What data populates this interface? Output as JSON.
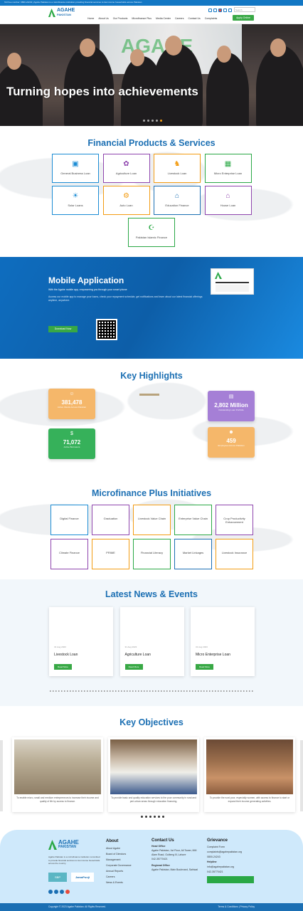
{
  "topbar": {
    "text": "Toll free number: 0800-24243 | Agahe Pakistan is a microfinance institution providing financial services to low income households across Pakistan"
  },
  "brand": {
    "name_line1": "AGAHE",
    "name_line2": "PAKISTAN"
  },
  "nav": {
    "items": [
      "Home",
      "About Us",
      "Our Products",
      "Microfinance Plus",
      "Media Center",
      "Careers",
      "Contact Us",
      "Complaints"
    ],
    "search_placeholder": "Search",
    "cta_label": "Apply Online"
  },
  "hero": {
    "title": "Turning hopes into achievements",
    "banner_text": "AGAHE"
  },
  "products": {
    "title": "Financial Products & Services",
    "items": [
      {
        "label": "General Business Loan",
        "color": "#1b8cd4",
        "icon": "briefcase-icon"
      },
      {
        "label": "Agriculture Loan",
        "color": "#8e44ad",
        "icon": "plant-icon"
      },
      {
        "label": "Livestock Loan",
        "color": "#f39c12",
        "icon": "cow-icon"
      },
      {
        "label": "Micro Enterprise Loan",
        "color": "#2aa845",
        "icon": "store-icon"
      },
      {
        "label": "Solar Loans",
        "color": "#1b8cd4",
        "icon": "sun-icon"
      },
      {
        "label": "Auto Loan",
        "color": "#f39c12",
        "icon": "bike-icon"
      },
      {
        "label": "Education Finance",
        "color": "#1b6fb3",
        "icon": "school-icon"
      },
      {
        "label": "House Loan",
        "color": "#8e44ad",
        "icon": "house-icon"
      },
      {
        "label": "Pakistan Islamic Finance",
        "color": "#2aa845",
        "icon": "islamic-icon"
      }
    ]
  },
  "mobile": {
    "title": "Mobile Application",
    "subtitle": "With the Agahe mobile app, empowering you through your smart phone",
    "body": "Access our mobile app to manage your loans, check your repayment schedule, get notifications and learn about our latest financial offerings anytime, anywhere.",
    "download_label": "Download Now"
  },
  "highlights": {
    "title": "Key Highlights",
    "stats": [
      {
        "value": "381,478",
        "label": "Active Clients Across Pakistan",
        "color": "#f5b76a"
      },
      {
        "value": "2,802 Million",
        "label": "Outstanding Loan Portfolio",
        "color": "#a57fd6"
      },
      {
        "value": "71,072",
        "label": "Active Borrowers",
        "color": "#36b15a"
      },
      {
        "value": "459",
        "label": "Employees Across Pakistan",
        "color": "#f5b76a"
      }
    ]
  },
  "initiatives": {
    "title": "Microfinance Plus Initiatives",
    "items": [
      {
        "label": "Digital Finance",
        "color": "#1b8cd4"
      },
      {
        "label": "Graduation",
        "color": "#8e44ad"
      },
      {
        "label": "Livestock Value Chain",
        "color": "#f39c12"
      },
      {
        "label": "Enterprise Value Chain",
        "color": "#2aa845"
      },
      {
        "label": "Crop Productivity Enhancement",
        "color": "#8e44ad"
      },
      {
        "label": "Climate Finance",
        "color": "#8e44ad"
      },
      {
        "label": "PRIME",
        "color": "#f39c12"
      },
      {
        "label": "Financial Literacy",
        "color": "#2aa845"
      },
      {
        "label": "Market Linkages",
        "color": "#1b6fb3"
      },
      {
        "label": "Livestock Insurance",
        "color": "#f39c12"
      }
    ]
  },
  "news": {
    "title": "Latest News & Events",
    "items": [
      {
        "date": "31 Aug 2023",
        "title": "Livestock Loan",
        "button": "Read More"
      },
      {
        "date": "31 Aug 2023",
        "title": "Agriculture Loan",
        "button": "Read More"
      },
      {
        "date": "31 Aug 2023",
        "title": "Micro Enterprise Loan",
        "button": "Read More"
      }
    ]
  },
  "objectives": {
    "title": "Key Objectives",
    "items": [
      {
        "caption": "To enable micro, small and medium entrepreneurs to increase their income and quality of life by access to finance."
      },
      {
        "caption": "To provide basic and quality education services to the poor community in rural and peri-urban areas through education financing."
      },
      {
        "caption": "To provide the rural poor, especially women, with access to finance to start or expand their income generating activities."
      }
    ]
  },
  "footer": {
    "tagline": "Agahe Pakistan is a microfinance institution committed to provide financial services to low income households across the country.",
    "about": {
      "title": "About",
      "links": [
        "About Agahe",
        "Board of Directors",
        "Management",
        "Corporate Governance",
        "Annual Reports",
        "Careers",
        "News & Events"
      ]
    },
    "contact": {
      "title": "Contact Us",
      "head_office_label": "Head Office",
      "head_office": "Agahe Pakistan, 1st Floor, Ali Tower, MM Alam Road, Gulberg III, Lahore",
      "phone": "042-35770421",
      "regional_label": "Regional Office",
      "regional": "Agahe Pakistan, Main Boulevard, Sahiwal"
    },
    "grievance": {
      "title": "Grievance",
      "items": [
        "Complaint Form",
        "complaints@agahepakistan.org",
        "0800-24243"
      ],
      "help_title": "Helpline",
      "help_items": [
        "info@agahepakistan.org",
        "042-35770421"
      ]
    },
    "partners": [
      "SBP",
      "JamaPunji"
    ],
    "bottom_left": "Copyright © 2023 Agahe Pakistan. All Rights Reserved.",
    "bottom_right": "Terms & Conditions | Privacy Policy"
  }
}
